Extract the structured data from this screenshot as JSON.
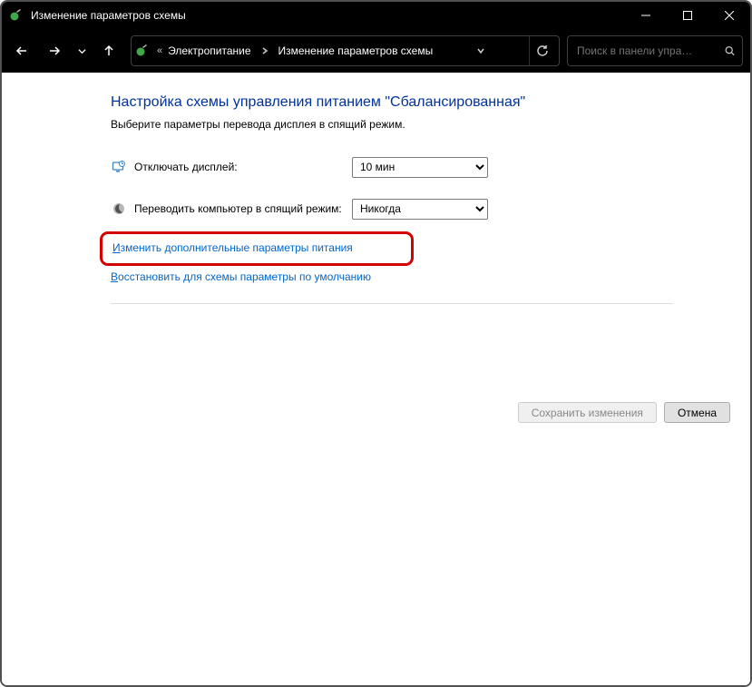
{
  "window": {
    "title": "Изменение параметров схемы"
  },
  "breadcrumb": {
    "prefix": "«",
    "item1": "Электропитание",
    "item2": "Изменение параметров схемы"
  },
  "search": {
    "placeholder": "Поиск в панели упра…"
  },
  "page": {
    "heading": "Настройка схемы управления питанием \"Сбалансированная\"",
    "sub": "Выберите параметры перевода дисплея в спящий режим."
  },
  "rows": {
    "display_off": {
      "label": "Отключать дисплей:",
      "value": "10 мин"
    },
    "sleep": {
      "label": "Переводить компьютер в спящий режим:",
      "value": "Никогда"
    }
  },
  "links": {
    "advanced_prefix": "И",
    "advanced_rest": "зменить дополнительные параметры питания",
    "restore_prefix": "В",
    "restore_rest": "осстановить для схемы параметры по умолчанию"
  },
  "buttons": {
    "save": "Сохранить изменения",
    "cancel": "Отмена"
  }
}
